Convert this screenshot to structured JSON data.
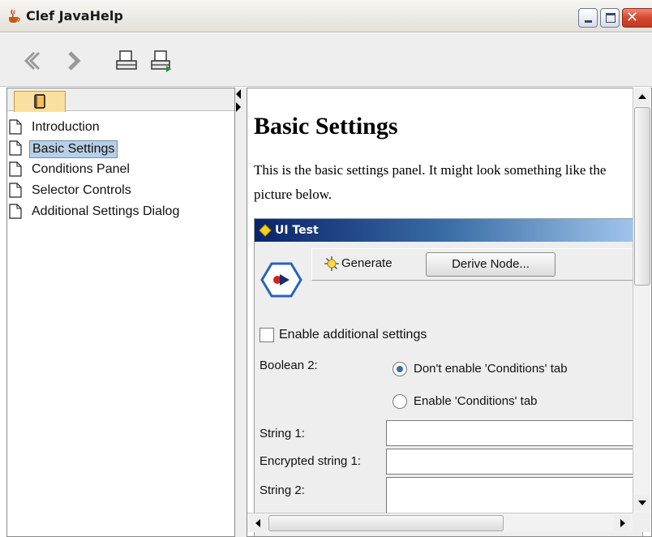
{
  "window": {
    "title": "Clef JavaHelp",
    "close_glyph": "✕"
  },
  "toolbar": {
    "icons": [
      "back-arrow-icon",
      "forward-arrow-icon",
      "print-icon",
      "page-setup-icon"
    ]
  },
  "navigator": {
    "tab_icon": "book-icon",
    "items": [
      {
        "label": "Introduction",
        "selected": false
      },
      {
        "label": "Basic Settings",
        "selected": true
      },
      {
        "label": "Conditions Panel",
        "selected": false
      },
      {
        "label": "Selector Controls",
        "selected": false
      },
      {
        "label": "Additional Settings Dialog",
        "selected": false
      }
    ]
  },
  "content": {
    "title": "Basic Settings",
    "body": "This is the basic settings panel. It might look something like the picture below."
  },
  "screenshot_dialog": {
    "title": "UI Test",
    "generate_label": "Generate",
    "derive_label": "Derive Node...",
    "checkbox_label": "Enable additional settings",
    "checkbox_checked": false,
    "boolean_label": "Boolean 2:",
    "radio_options": [
      {
        "label": "Don't enable 'Conditions' tab",
        "selected": true
      },
      {
        "label": "Enable 'Conditions' tab",
        "selected": false
      }
    ],
    "fields": [
      {
        "label": "String 1:",
        "value": ""
      },
      {
        "label": "Encrypted string 1:",
        "value": ""
      },
      {
        "label": "String 2:",
        "value": ""
      }
    ]
  },
  "colors": {
    "selection": "#b8cfe5",
    "dialog_title_start": "#0a246a",
    "tab_highlight": "#f9e0a0"
  }
}
